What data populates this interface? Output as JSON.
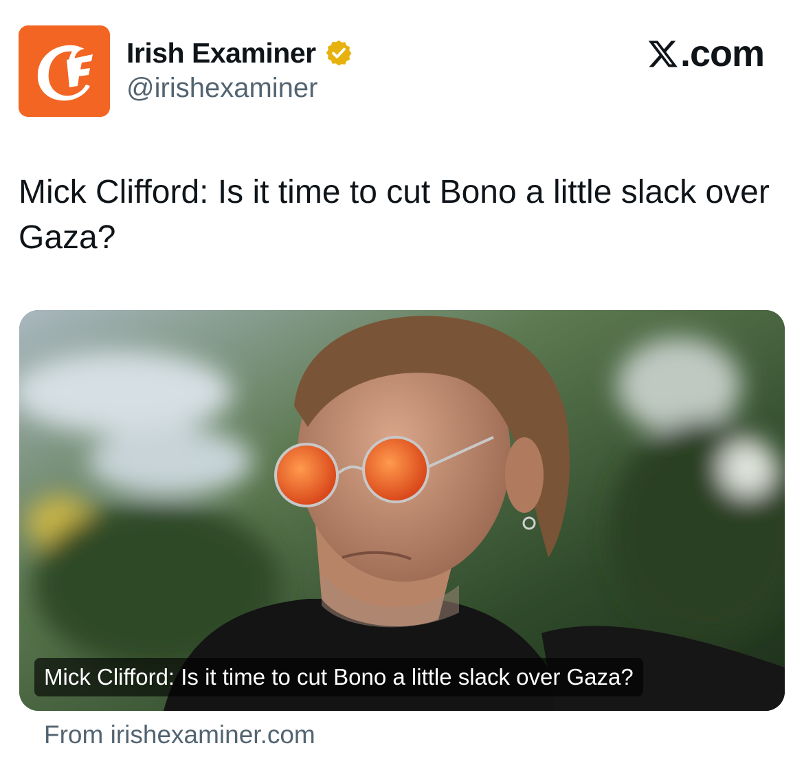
{
  "account": {
    "display_name": "Irish Examiner",
    "handle": "@irishexaminer",
    "verified": true,
    "avatar_letter": "E",
    "avatar_color": "#f26522",
    "badge_color": "#e8b20e"
  },
  "platform": {
    "logo_text": ".com",
    "logo_icon": "x-logo-icon"
  },
  "tweet": {
    "text": "Mick Clifford: Is it time to cut Bono a little slack over Gaza?"
  },
  "link_card": {
    "image_alt_icon": "photo",
    "caption": "Mick Clifford: Is it time to cut Bono a little slack over Gaza?",
    "source": "From irishexaminer.com"
  }
}
